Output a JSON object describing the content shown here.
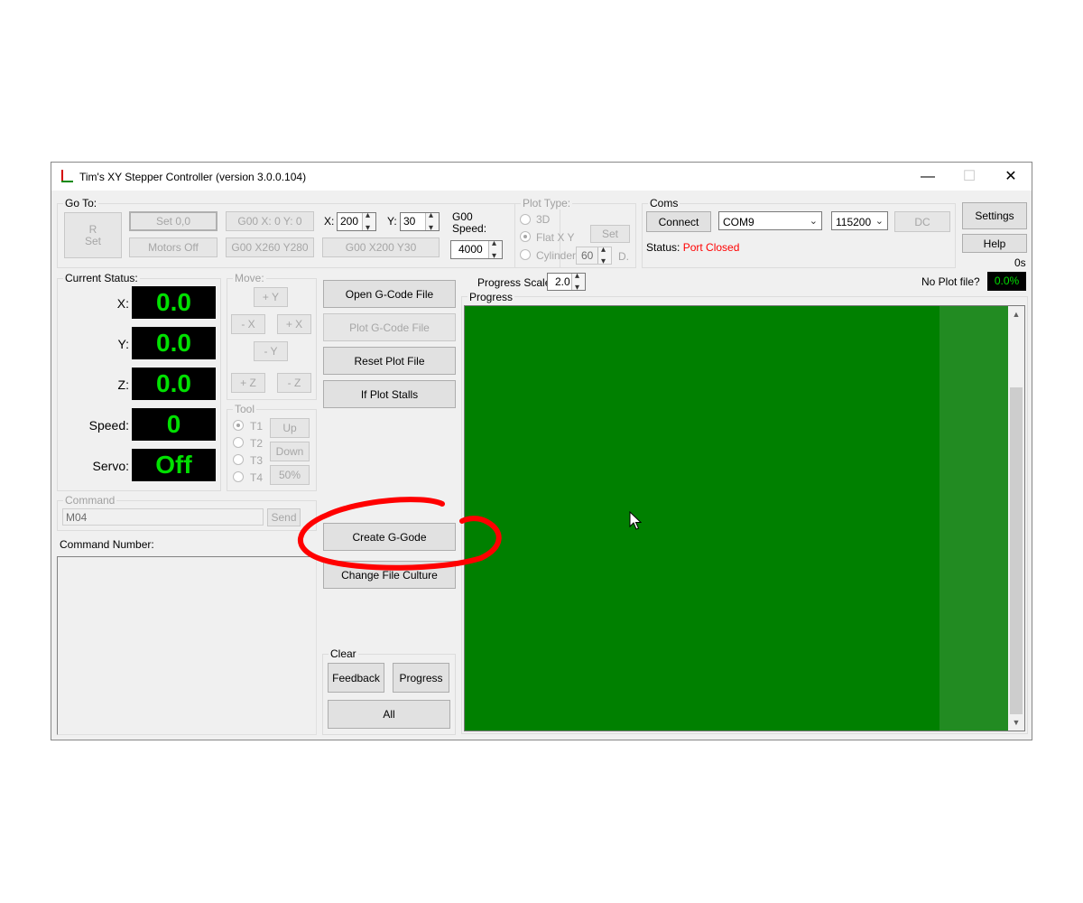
{
  "window": {
    "title": "Tim's XY Stepper Controller (version 3.0.0.104)",
    "minimize": "—",
    "maximize": "☐",
    "close": "✕"
  },
  "goto": {
    "label": "Go To:",
    "r_set_line1": "R",
    "r_set_line2": "Set",
    "set_00": "Set 0,0",
    "motors_off": "Motors Off",
    "g00_x0_y0": "G00 X: 0 Y: 0",
    "g00_x260_y280": "G00 X260 Y280",
    "x_label": "X:",
    "x_value": "200",
    "y_label": "Y:",
    "y_value": "30",
    "g00_x200_y30": "G00 X200 Y30",
    "g00_speed_line1": "G00",
    "g00_speed_line2": "Speed:",
    "speed_value": "4000"
  },
  "plot_type": {
    "label": "Plot Type:",
    "opt_3d": "3D",
    "opt_flat": "Flat X Y",
    "opt_cylinder": "Cylinder",
    "set": "Set",
    "cyl_value": "60",
    "cyl_unit": "D."
  },
  "coms": {
    "label": "Coms",
    "connect": "Connect",
    "port": "COM9",
    "baud": "115200",
    "dc": "DC",
    "status_label": "Status:",
    "status_value": "Port Closed",
    "status_color": "#ff0000"
  },
  "side": {
    "settings": "Settings",
    "help": "Help",
    "time": "0s"
  },
  "current_status": {
    "label": "Current Status:",
    "x_label": "X:",
    "x_value": "0.0",
    "y_label": "Y:",
    "y_value": "0.0",
    "z_label": "Z:",
    "z_value": "0.0",
    "speed_label": "Speed:",
    "speed_value": "0",
    "servo_label": "Servo:",
    "servo_value": "Off"
  },
  "move": {
    "label": "Move:",
    "plus_y": "+ Y",
    "minus_x": "- X",
    "plus_x": "+ X",
    "minus_y": "- Y",
    "plus_z": "+ Z",
    "minus_z": "- Z"
  },
  "tool": {
    "label": "Tool",
    "t1": "T1",
    "t2": "T2",
    "t3": "T3",
    "t4": "T4",
    "up": "Up",
    "down": "Down",
    "pct": "50%"
  },
  "command": {
    "label": "Command",
    "value": "M04",
    "send": "Send",
    "number_label": "Command Number:"
  },
  "actions": {
    "open_gcode": "Open G-Code File",
    "plot_gcode": "Plot G-Code File",
    "reset_plot": "Reset Plot File",
    "if_plot_stalls": "If Plot Stalls",
    "create_gcode": "Create G-Gode",
    "change_culture": "Change File Culture"
  },
  "clear": {
    "label": "Clear",
    "feedback": "Feedback",
    "progress": "Progress",
    "all": "All"
  },
  "progress": {
    "scale_label": "Progress Scale:",
    "scale_value": "2.0",
    "plot_file_label": "No Plot file?",
    "percent": "0.0%",
    "percent_value": 0.0,
    "group_label": "Progress",
    "fill_color": "#008000",
    "scroll_up": "▲",
    "scroll_down": "▼"
  },
  "colors": {
    "lcd_text": "#00e000",
    "lcd_bg": "#000000",
    "annotation": "#ff0000"
  }
}
